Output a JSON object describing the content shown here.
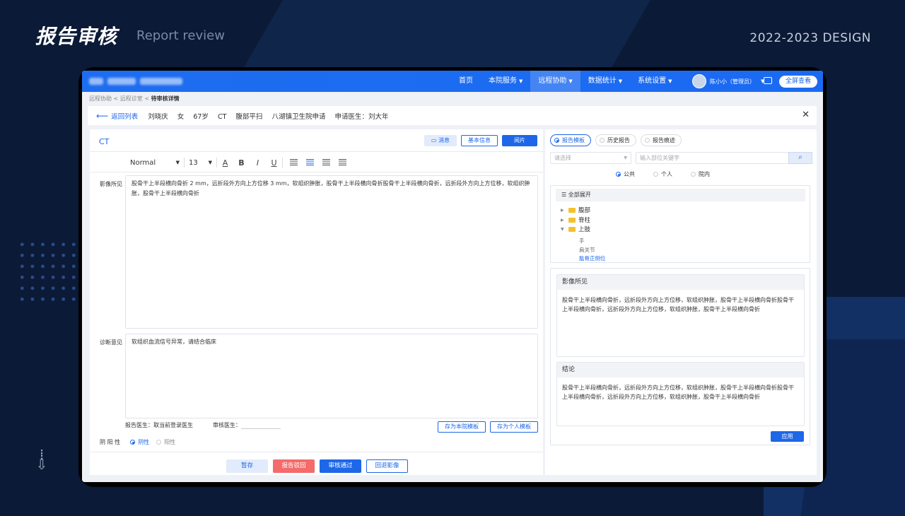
{
  "header": {
    "title_cn": "报告审核",
    "title_en": "Report review",
    "year_tag": "2022-2023  DESIGN"
  },
  "nav": {
    "items": [
      {
        "label": "首页",
        "dropdown": false
      },
      {
        "label": "本院服务",
        "dropdown": true
      },
      {
        "label": "远程协助",
        "dropdown": true,
        "active": true
      },
      {
        "label": "数据统计",
        "dropdown": true
      },
      {
        "label": "系统设置",
        "dropdown": true
      }
    ],
    "user": "陈小小（管理员）",
    "fullscreen": "全屏查看"
  },
  "breadcrumb": {
    "parts": "远程协助 < 远程诊室 < ",
    "current": "待审核详情"
  },
  "patient_bar": {
    "back": "返回列表",
    "name": "刘晓庆",
    "sex": "女",
    "age": "67岁",
    "modality": "CT",
    "exam": "腹部平扫",
    "hospital": "八湖镇卫生院申请",
    "doctor": "申请医生：刘大年"
  },
  "left": {
    "modality": "CT",
    "buttons": {
      "message": "消息",
      "basic_info": "基本信息",
      "read_film": "阅片"
    },
    "toolbar": {
      "style": "Normal",
      "size": "13"
    },
    "findings_label": "影像所见",
    "findings_text": "股骨干上半段横向骨折  2 mm，远折段外方向上方位移 3 mm，软组织肿胀，股骨干上半段横向骨折股骨干上半段横向骨折，远折段外方向上方位移，软组织肿胀，股骨干上半段横向骨折",
    "diagnosis_label": "诊断意见",
    "diagnosis_text": "软组织血流信号异常，请结合临床",
    "report_doctor": "报告医生：取当前登录医生",
    "review_doctor": "审核医生：",
    "save_hospital_tpl": "存为本院模板",
    "save_personal_tpl": "存为个人模板",
    "yinyang_label": "阴 阳 性",
    "negative": "阴性",
    "positive": "阳性",
    "actions": {
      "temp_save": "暂存",
      "reject": "报告驳回",
      "approve": "审核通过",
      "back_image": "回退影像"
    }
  },
  "right": {
    "tabs": [
      "报告模板",
      "历史报告",
      "报告痕迹"
    ],
    "select_placeholder": "请选择",
    "search_placeholder": "输入部位关键字",
    "scopes": [
      "公共",
      "个人",
      "院内"
    ],
    "tree_head": "全部展开",
    "tree": [
      "腹部",
      "脊柱",
      "上肢"
    ],
    "leaves": [
      "手",
      "肩关节",
      "肱骨正侧位"
    ],
    "findings_title": "影像所见",
    "findings_text": "股骨干上半段横向骨折，远折段外方向上方位移，软组织肿胀，股骨干上半段横向骨折股骨干上半段横向骨折，远折段外方向上方位移，软组织肿胀，股骨干上半段横向骨折",
    "conclusion_title": "结论",
    "conclusion_text": "股骨干上半段横向骨折，远折段外方向上方位移，软组织肿胀，股骨干上半段横向骨折股骨干上半段横向骨折，远折段外方向上方位移，软组织肿胀，股骨干上半段横向骨折",
    "apply": "应用"
  },
  "colors": {
    "primary": "#1d67e8",
    "danger": "#f46b6b",
    "bg_dark": "#0b1a36"
  }
}
